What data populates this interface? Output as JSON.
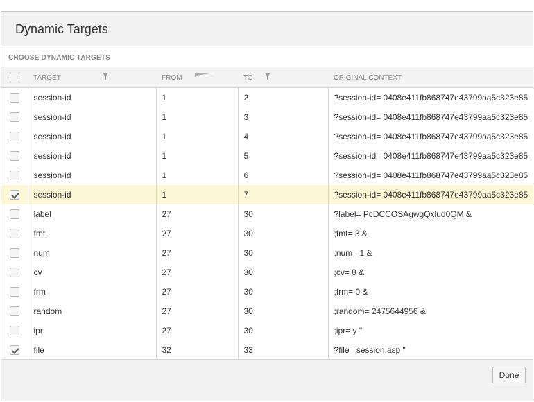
{
  "dialog": {
    "title": "Dynamic Targets",
    "section_label": "CHOOSE DYNAMIC TARGETS",
    "done_label": "Done"
  },
  "table": {
    "headers": {
      "target": "TARGET",
      "from": "FROM",
      "to": "TO",
      "context": "ORIGINAL CONTEXT"
    },
    "rows": [
      {
        "checked": false,
        "target": "session-id",
        "from": "1",
        "to": "2",
        "context": "?session-id= 0408e411fb868747e43799aa5c323e85"
      },
      {
        "checked": false,
        "target": "session-id",
        "from": "1",
        "to": "3",
        "context": "?session-id= 0408e411fb868747e43799aa5c323e85"
      },
      {
        "checked": false,
        "target": "session-id",
        "from": "1",
        "to": "4",
        "context": "?session-id= 0408e411fb868747e43799aa5c323e85"
      },
      {
        "checked": false,
        "target": "session-id",
        "from": "1",
        "to": "5",
        "context": "?session-id= 0408e411fb868747e43799aa5c323e85"
      },
      {
        "checked": false,
        "target": "session-id",
        "from": "1",
        "to": "6",
        "context": "?session-id= 0408e411fb868747e43799aa5c323e85"
      },
      {
        "checked": true,
        "highlight": true,
        "target": "session-id",
        "from": "1",
        "to": "7",
        "context": "?session-id= 0408e411fb868747e43799aa5c323e85"
      },
      {
        "checked": false,
        "target": "label",
        "from": "27",
        "to": "30",
        "context": "?label= PcDCCOSAgwgQxlud0QM &"
      },
      {
        "checked": false,
        "target": "fmt",
        "from": "27",
        "to": "30",
        "context": ";fmt= 3 &"
      },
      {
        "checked": false,
        "target": "num",
        "from": "27",
        "to": "30",
        "context": ";num= 1 &"
      },
      {
        "checked": false,
        "target": "cv",
        "from": "27",
        "to": "30",
        "context": ";cv= 8 &"
      },
      {
        "checked": false,
        "target": "frm",
        "from": "27",
        "to": "30",
        "context": ";frm= 0 &"
      },
      {
        "checked": false,
        "target": "random",
        "from": "27",
        "to": "30",
        "context": ";random= 2475644956 &"
      },
      {
        "checked": false,
        "target": "ipr",
        "from": "27",
        "to": "30",
        "context": ";ipr= y \""
      },
      {
        "checked": true,
        "target": "file",
        "from": "32",
        "to": "33",
        "context": "?file= session.asp \""
      }
    ]
  }
}
